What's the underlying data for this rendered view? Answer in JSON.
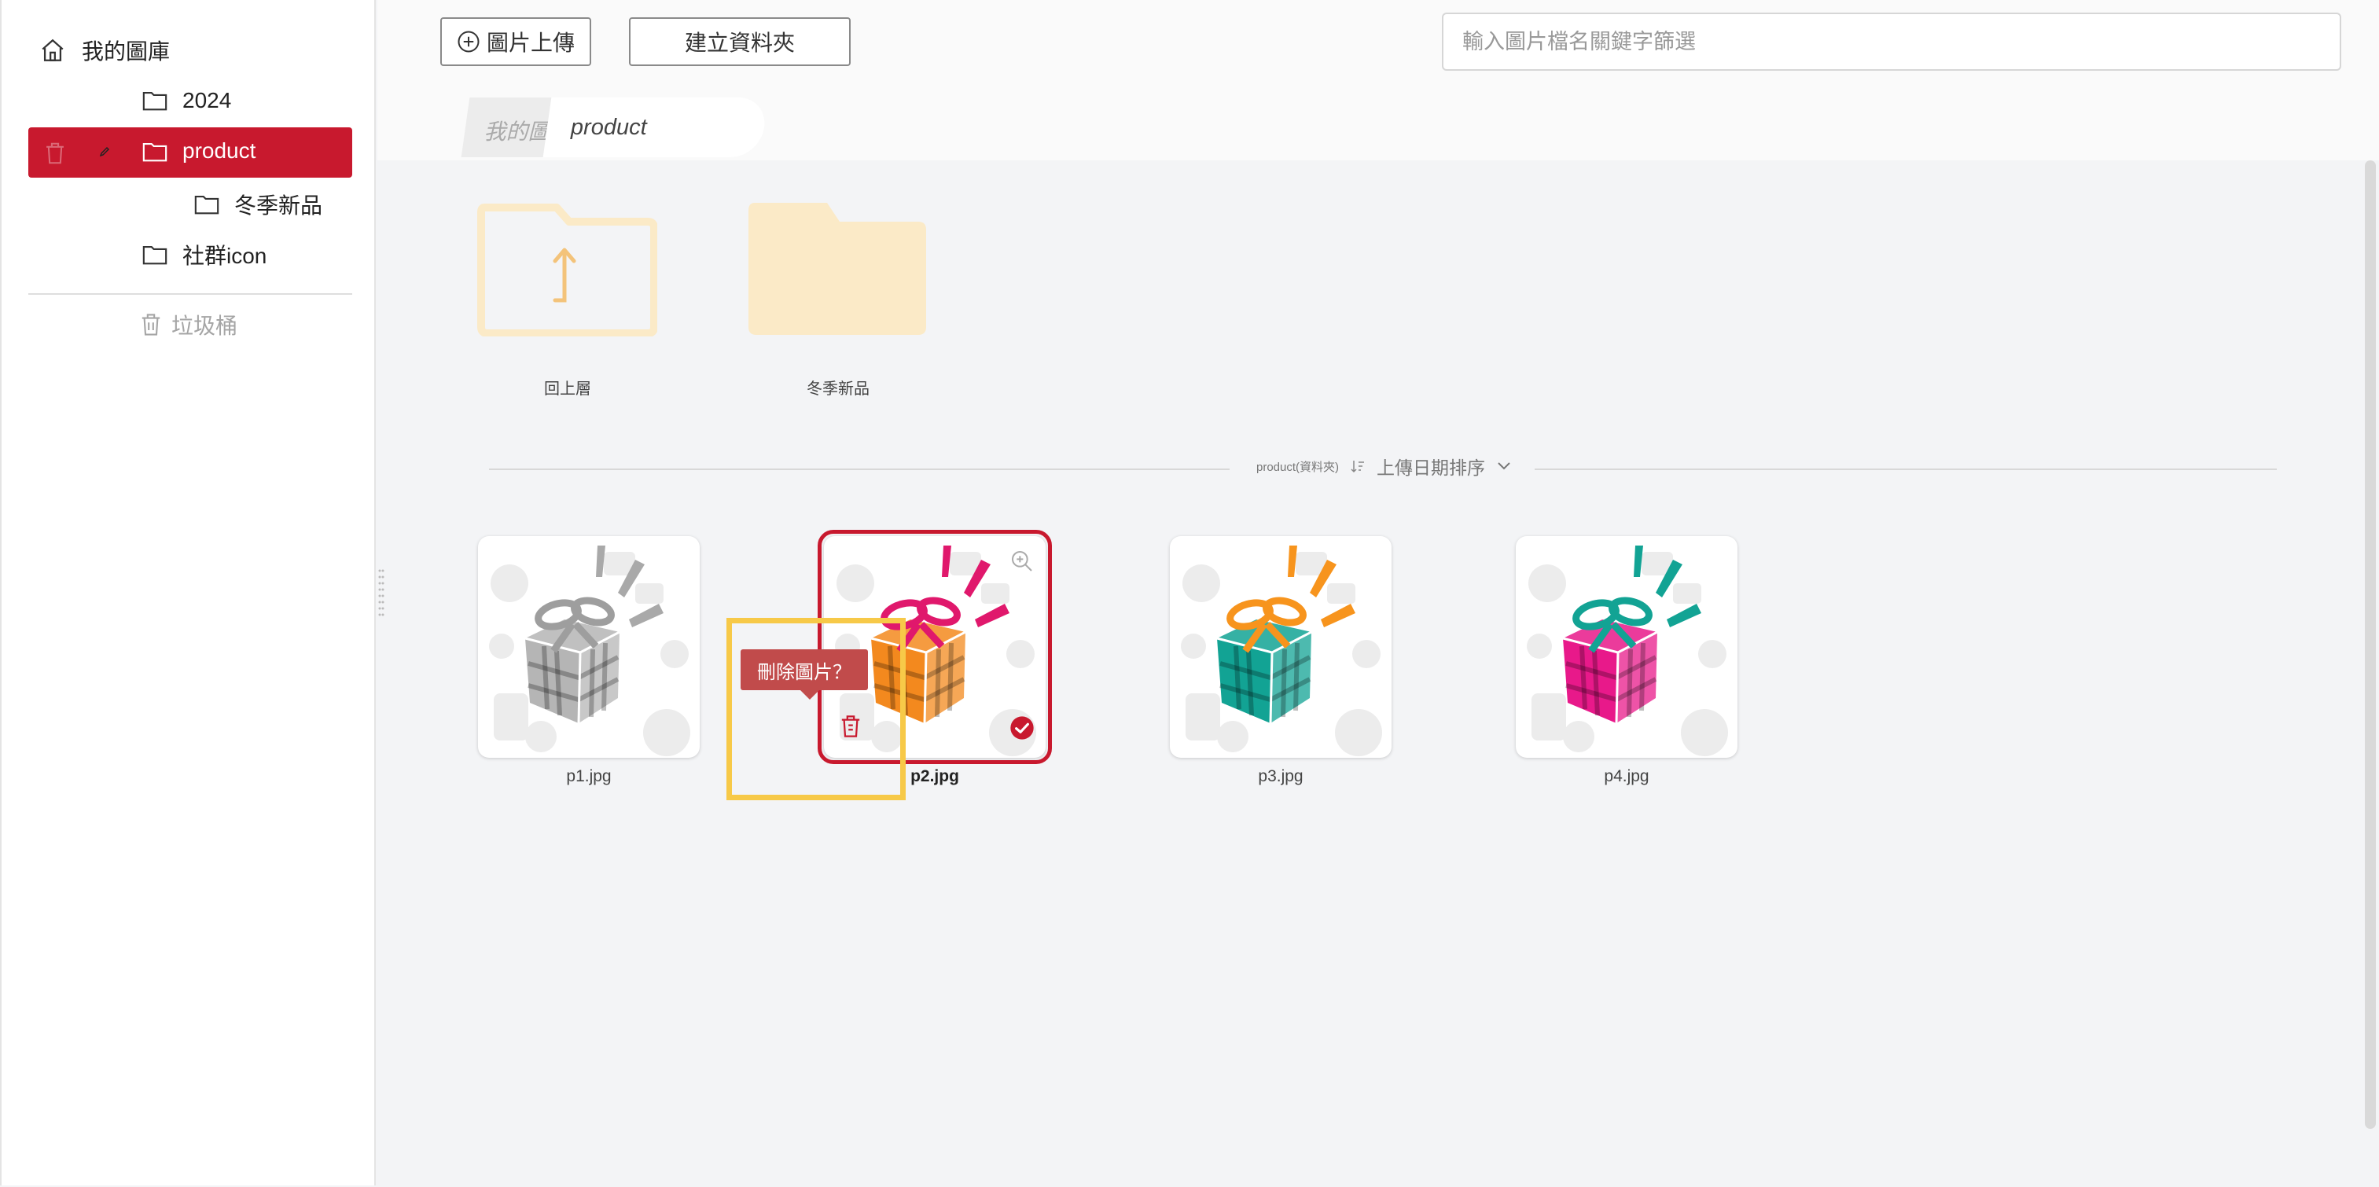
{
  "sidebar": {
    "root_label": "我的圖庫",
    "items": [
      {
        "label": "2024"
      },
      {
        "label": "product",
        "selected": true
      },
      {
        "label": "冬季新品"
      },
      {
        "label": "社群icon"
      }
    ],
    "trash_label": "垃圾桶"
  },
  "toolbar": {
    "upload_label": "圖片上傳",
    "new_folder_label": "建立資料夾",
    "search_placeholder": "輸入圖片檔名關鍵字篩選"
  },
  "breadcrumb": {
    "previous": "我的圖",
    "current": "product"
  },
  "folders": [
    {
      "label": "回上層"
    },
    {
      "label": "冬季新品"
    }
  ],
  "sort": {
    "folder_label": "product(資料夾)",
    "sort_label": "上傳日期排序"
  },
  "images": [
    {
      "name": "p1.jpg",
      "color": "#b5b5b5",
      "ribbon": "#9e9e9e",
      "burst": "#a9a9a9"
    },
    {
      "name": "p2.jpg",
      "color": "#f3891e",
      "ribbon": "#e0186c",
      "burst": "#e0186c",
      "selected": true
    },
    {
      "name": "p3.jpg",
      "color": "#12a394",
      "ribbon": "#f7941d",
      "burst": "#f7941d"
    },
    {
      "name": "p4.jpg",
      "color": "#e8198a",
      "ribbon": "#12a394",
      "burst": "#12a394"
    }
  ],
  "tooltip": {
    "text": "刪除圖片？"
  },
  "colors": {
    "accent": "#c8192e",
    "highlight": "#f7c948",
    "folder": "#fbeac7"
  }
}
